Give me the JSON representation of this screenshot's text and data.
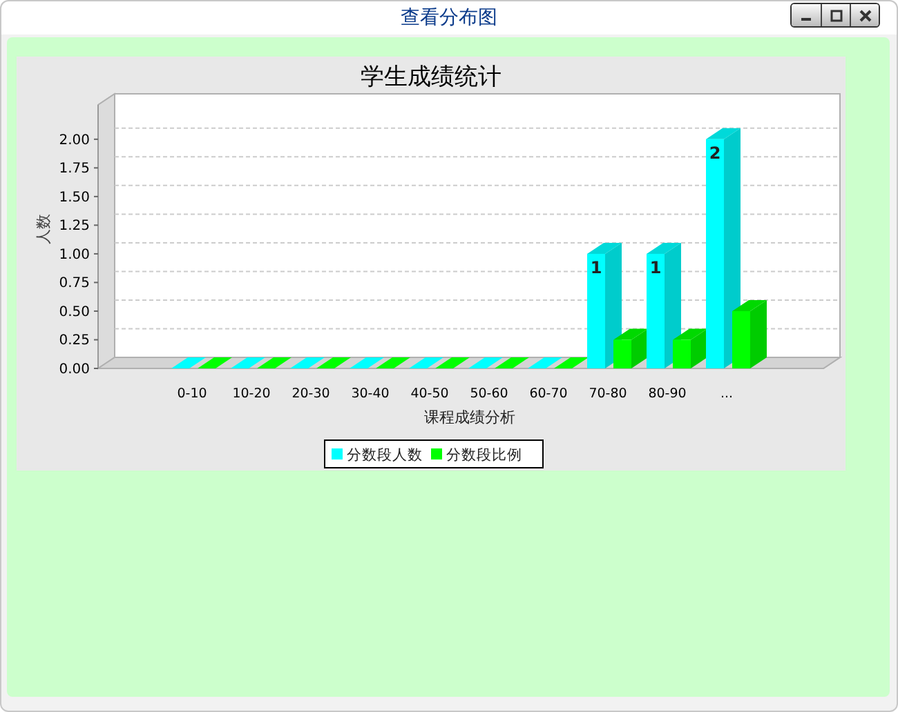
{
  "window": {
    "title": "查看分布图"
  },
  "chart_data": {
    "type": "bar",
    "title": "学生成绩统计",
    "xlabel": "课程成绩分析",
    "ylabel": "人数",
    "categories": [
      "0-10",
      "10-20",
      "20-30",
      "30-40",
      "40-50",
      "50-60",
      "60-70",
      "70-80",
      "80-90",
      "..."
    ],
    "series": [
      {
        "name": "分数段人数",
        "color": "#00ffff",
        "values": [
          0,
          0,
          0,
          0,
          0,
          0,
          0,
          1,
          1,
          2
        ]
      },
      {
        "name": "分数段比例",
        "color": "#00ff00",
        "values": [
          0,
          0,
          0,
          0,
          0,
          0,
          0,
          0.25,
          0.25,
          0.5
        ]
      }
    ],
    "ylim": [
      0,
      2.3
    ],
    "yticks": [
      {
        "value": 0,
        "label": "0.00"
      },
      {
        "value": 0.25,
        "label": "0.25"
      },
      {
        "value": 0.5,
        "label": "0.50"
      },
      {
        "value": 0.75,
        "label": "0.75"
      },
      {
        "value": 1,
        "label": "1.00"
      },
      {
        "value": 1.25,
        "label": "1.25"
      },
      {
        "value": 1.5,
        "label": "1.50"
      },
      {
        "value": 1.75,
        "label": "1.75"
      },
      {
        "value": 2,
        "label": "2.00"
      }
    ],
    "legend": true,
    "annotations": [
      {
        "x": "70-80",
        "y": 1,
        "text": "1"
      },
      {
        "x": "80-90",
        "y": 1,
        "text": "1"
      },
      {
        "x": "...",
        "y": 2,
        "text": "2"
      }
    ]
  }
}
